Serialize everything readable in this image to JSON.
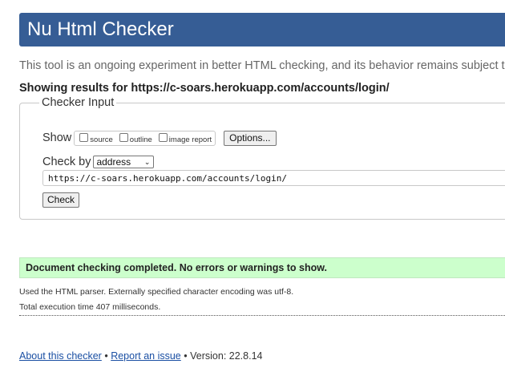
{
  "header": {
    "title": "Nu Html Checker"
  },
  "intro_text": "This tool is an ongoing experiment in better HTML checking, and its behavior remains subject to",
  "showing": {
    "text": "Showing results for https://c-soars.herokuapp.com/accounts/login/"
  },
  "checker_input": {
    "legend": "Checker Input",
    "show_label": "Show",
    "options": [
      {
        "label": "source",
        "checked": false
      },
      {
        "label": "outline",
        "checked": false
      },
      {
        "label": "image report",
        "checked": false
      }
    ],
    "options_button": "Options...",
    "check_by_label": "Check by",
    "check_by_selected": "address",
    "url_value": "https://c-soars.herokuapp.com/accounts/login/",
    "check_button": "Check"
  },
  "result": {
    "message": "Document checking completed. No errors or warnings to show."
  },
  "details": {
    "parser": "Used the HTML parser. Externally specified character encoding was utf-8.",
    "time": "Total execution time 407 milliseconds."
  },
  "footer": {
    "about_link": "About this checker",
    "separator": "•",
    "report_link": "Report an issue",
    "version": "Version: 22.8.14"
  },
  "colors": {
    "header_bg": "#365d95",
    "success_bg": "#ccffcc",
    "link": "#1a4fa3"
  }
}
